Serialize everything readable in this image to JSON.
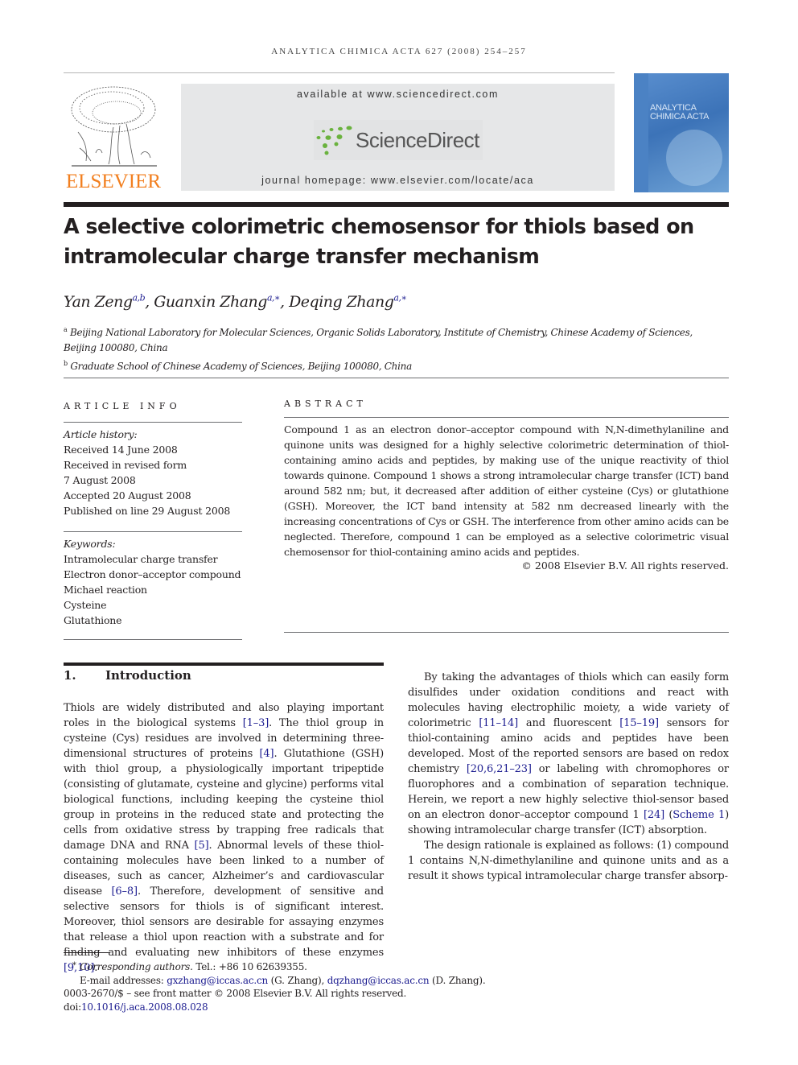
{
  "running_header": "ANALYTICA CHIMICA ACTA 627 (2008) 254–257",
  "masthead": {
    "publisher_logo_text": "ELSEVIER",
    "available_at": "available at www.sciencedirect.com",
    "sciencedirect_logo_text": "ScienceDirect",
    "journal_homepage": "journal homepage: www.elsevier.com/locate/aca",
    "cover_title_line1": "ANALYTICA",
    "cover_title_line2": "CHIMICA ACTA",
    "colors": {
      "elsevier_orange": "#f27f1f",
      "sciencedirect_green": "#6ab23e",
      "cover_blue": "#3c73b8",
      "link_blue": "#1b1b8f"
    }
  },
  "title_line1": "A selective colorimetric chemosensor for thiols based on",
  "title_line2": "intramolecular charge transfer mechanism",
  "authors": [
    {
      "name": "Yan Zeng",
      "sup": "a,b",
      "sep": ", "
    },
    {
      "name": "Guanxin Zhang",
      "sup": "a,∗",
      "sep": ", "
    },
    {
      "name": "Deqing Zhang",
      "sup": "a,∗",
      "sep": ""
    }
  ],
  "affiliations": [
    {
      "mark": "a",
      "line1": "Beijing National Laboratory for Molecular Sciences, Organic Solids Laboratory, Institute of Chemistry, Chinese Academy of Sciences,",
      "line2": "Beijing 100080, China"
    },
    {
      "mark": "b",
      "line1": "Graduate School of Chinese Academy of Sciences, Beijing 100080, China"
    }
  ],
  "article_info": {
    "heading": "Article Info",
    "history_label": "Article history:",
    "history": [
      "Received 14 June 2008",
      "Received in revised form",
      "7 August 2008",
      "Accepted 20 August 2008",
      "Published on line 29 August 2008"
    ],
    "keywords_label": "Keywords:",
    "keywords": [
      "Intramolecular charge transfer",
      "Electron donor–acceptor compound",
      "Michael reaction",
      "Cysteine",
      "Glutathione"
    ]
  },
  "abstract": {
    "heading": "Abstract",
    "text": "Compound 1 as an electron donor–acceptor compound with N,N-dimethylaniline and quinone units was designed for a highly selective colorimetric determination of thiol-containing amino acids and peptides, by making use of the unique reactivity of thiol towards quinone. Compound 1 shows a strong intramolecular charge transfer (ICT) band around 582 nm; but, it decreased after addition of either cysteine (Cys) or glutathione (GSH). Moreover, the ICT band intensity at 582 nm decreased linearly with the increasing concentrations of Cys or GSH. The interference from other amino acids can be neglected. Therefore, compound 1 can be employed as a selective colorimetric visual chemosensor for thiol-containing amino acids and peptides.",
    "copyright": "© 2008 Elsevier B.V. All rights reserved."
  },
  "intro": {
    "number": "1.",
    "heading": "Introduction",
    "p1": [
      {
        "t": "Thiols are widely distributed and also playing important roles in the biological systems "
      },
      {
        "r": "[1–3]"
      },
      {
        "t": ". The thiol group in cysteine (Cys) residues are involved in determining three-dimensional structures of proteins "
      },
      {
        "r": "[4]"
      },
      {
        "t": ". Glutathione (GSH) with thiol group, a physiologically important tripeptide (consisting of glutamate, cysteine and glycine) performs vital biological functions, including keeping the cysteine thiol group in proteins in the reduced state and protecting the cells from oxidative stress by trapping free radicals that damage DNA and RNA "
      },
      {
        "r": "[5]"
      },
      {
        "t": ". Abnormal levels of these thiol-containing molecules have been linked to a number of diseases, such as cancer, Alzheimer’s and cardiovascular disease "
      },
      {
        "r": "[6–8]"
      },
      {
        "t": ". Therefore, development of sensitive and selective sensors for thiols is of significant interest. Moreover, thiol sensors are desirable for assaying enzymes that release a thiol upon reaction with a substrate and for finding and evaluating new inhibitors of these enzymes "
      },
      {
        "r": "[9,10]"
      },
      {
        "t": "."
      }
    ],
    "p2": [
      {
        "t": "By taking the advantages of thiols which can easily form disulfides under oxidation conditions and react with molecules having electrophilic moiety, a wide variety of colorimetric "
      },
      {
        "r": "[11–14]"
      },
      {
        "t": " and fluorescent "
      },
      {
        "r": "[15–19]"
      },
      {
        "t": " sensors for thiol-containing amino acids and peptides have been developed. Most of the reported sensors are based on redox chemistry "
      },
      {
        "r": "[20,6,21–23]"
      },
      {
        "t": " or labeling with chromophores or fluorophores and a combination of separation technique. Herein, we report a new highly selective thiol-sensor based on an electron donor–acceptor compound 1 "
      },
      {
        "r": "[24]"
      },
      {
        "t": " ("
      },
      {
        "r": "Scheme 1"
      },
      {
        "t": ") showing intramolecular charge transfer (ICT) absorption."
      }
    ],
    "p3": [
      {
        "t": "The design rationale is explained as follows: (1) compound 1 contains N,N-dimethylaniline and quinone units and as a result it shows typical intramolecular charge transfer absorp-"
      }
    ]
  },
  "footnotes": {
    "corresponding_mark": "∗",
    "corresponding_label": "Corresponding authors.",
    "tel": " Tel.: +86 10 62639355.",
    "email_label": "E-mail addresses: ",
    "email1": "gxzhang@iccas.ac.cn",
    "email1_name": " (G. Zhang), ",
    "email2": "dqzhang@iccas.ac.cn",
    "email2_name": " (D. Zhang).",
    "front_matter": "0003-2670/$ – see front matter © 2008 Elsevier B.V. All rights reserved.",
    "doi_label": "doi:",
    "doi": "10.1016/j.aca.2008.08.028"
  }
}
